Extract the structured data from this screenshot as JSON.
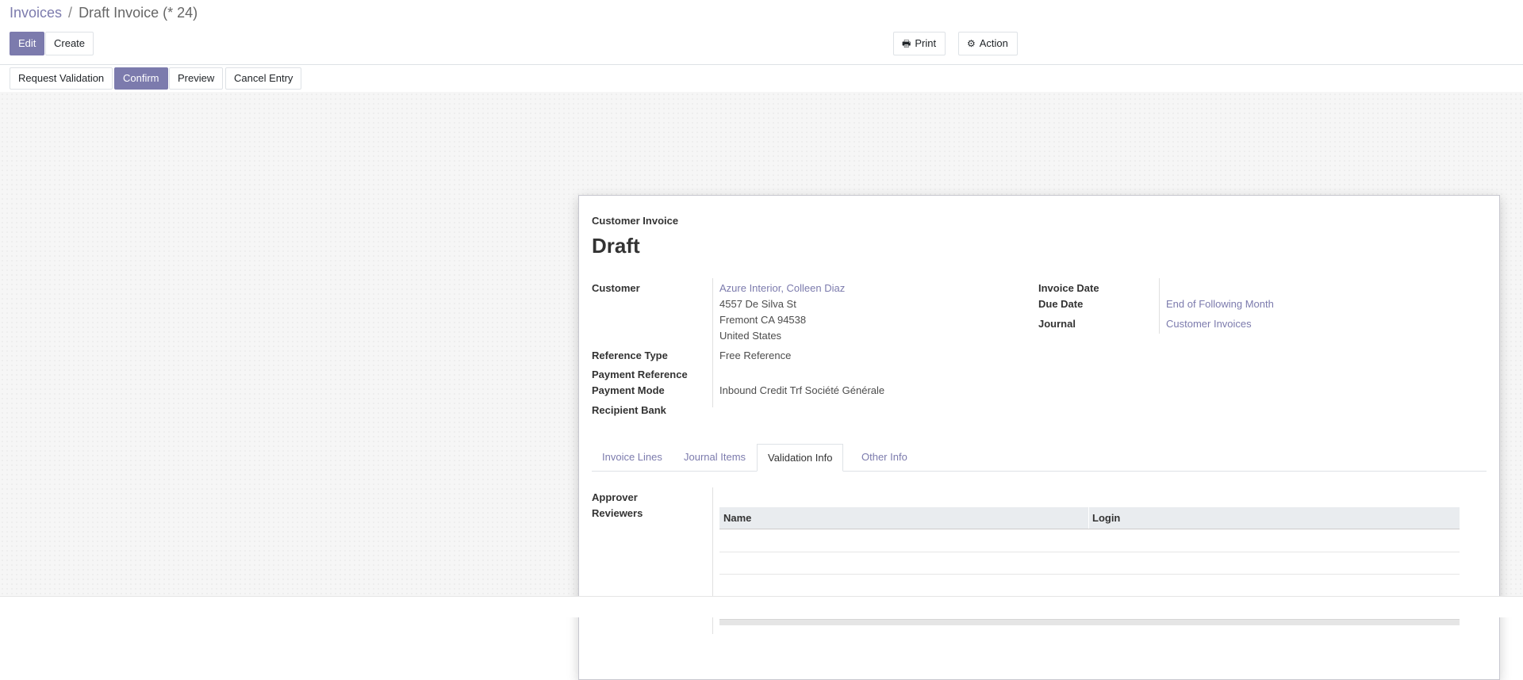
{
  "breadcrumb": {
    "parent": "Invoices",
    "separator": "/",
    "current": "Draft Invoice (* 24)"
  },
  "toolbar": {
    "edit": "Edit",
    "create": "Create",
    "print": "Print",
    "action": "Action"
  },
  "statusbar": {
    "request_validation": "Request Validation",
    "confirm": "Confirm",
    "preview": "Preview",
    "cancel_entry": "Cancel Entry"
  },
  "invoice": {
    "type_label": "Customer Invoice",
    "status": "Draft",
    "customer_label": "Customer",
    "customer_name": "Azure Interior, Colleen Diaz",
    "address_line1": "4557 De Silva St",
    "address_line2": "Fremont CA 94538",
    "address_line3": "United States",
    "reference_type_label": "Reference Type",
    "reference_type_value": "Free Reference",
    "payment_reference_label": "Payment Reference",
    "payment_mode_label": "Payment Mode",
    "payment_mode_value": "Inbound Credit Trf Société Générale",
    "recipient_bank_label": "Recipient Bank",
    "invoice_date_label": "Invoice Date",
    "due_date_label": "Due Date",
    "due_date_value": "End of Following Month",
    "journal_label": "Journal",
    "journal_value": "Customer Invoices"
  },
  "tabs": [
    {
      "label": "Invoice Lines",
      "active": false
    },
    {
      "label": "Journal Items",
      "active": false
    },
    {
      "label": "Validation Info",
      "active": true
    },
    {
      "label": "Other Info",
      "active": false
    }
  ],
  "validation": {
    "approver_label": "Approver",
    "reviewers_label": "Reviewers",
    "columns": [
      "Name",
      "Login"
    ],
    "rows": []
  },
  "colors": {
    "accent": "#7c7bad",
    "border": "#dee2e6",
    "background": "#f6f6f6"
  },
  "icons": {
    "print": "printer-icon",
    "action": "gear-icon"
  }
}
